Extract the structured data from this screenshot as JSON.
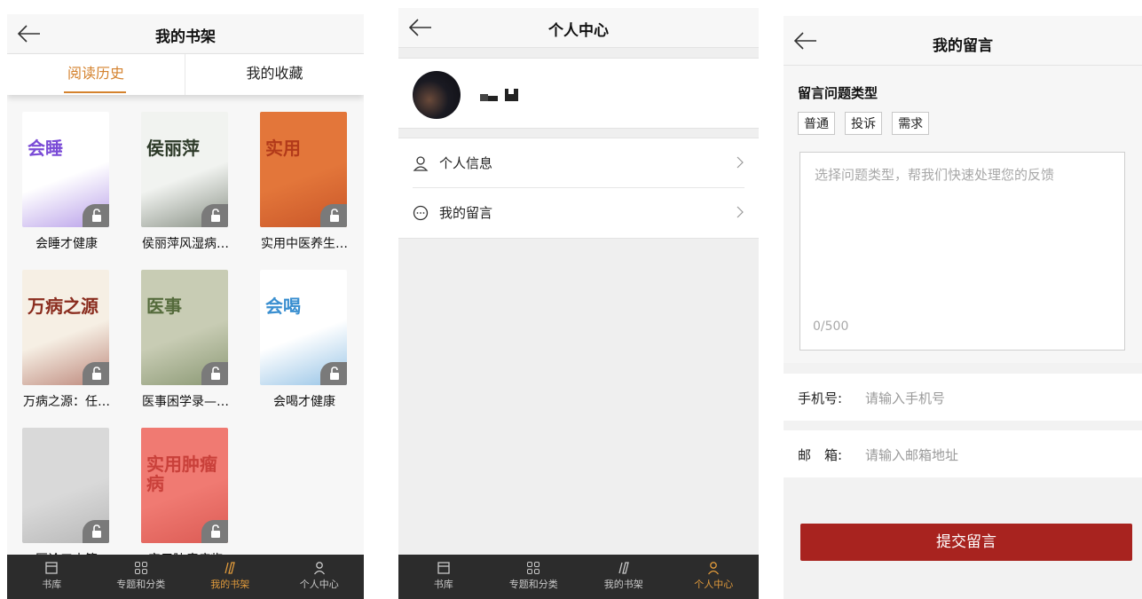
{
  "bookshelf": {
    "title": "我的书架",
    "tabs": [
      "阅读历史",
      "我的收藏"
    ],
    "books": [
      {
        "title": "会睡才健康",
        "cover_text": "会睡",
        "cover_color": "#ffffff",
        "accent": "#7a4bd6"
      },
      {
        "title": "侯丽萍风湿病…",
        "cover_text": "侯丽萍",
        "cover_color": "#f1f3f0",
        "accent": "#2d3a28"
      },
      {
        "title": "实用中医养生…",
        "cover_text": "实用",
        "cover_color": "#e3763a",
        "accent": "#b23a1a"
      },
      {
        "title": "万病之源：任…",
        "cover_text": "万病之源",
        "cover_color": "#f6efe4",
        "accent": "#8a2c1e"
      },
      {
        "title": "医事困学录—…",
        "cover_text": "医事",
        "cover_color": "#c8ccb4",
        "accent": "#556b3c"
      },
      {
        "title": "会喝才健康",
        "cover_text": "会喝",
        "cover_color": "#ffffff",
        "accent": "#3a8fd0"
      },
      {
        "title": "医论三十篇",
        "cover_text": "",
        "cover_color": "#d9d9d9",
        "accent": "#9a9a9a"
      },
      {
        "title": "实用肿瘤病临",
        "cover_text": "实用肿瘤病",
        "cover_color": "#f07a72",
        "accent": "#c9403a"
      }
    ]
  },
  "tabbar": {
    "items": [
      "书库",
      "专题和分类",
      "我的书架",
      "个人中心"
    ]
  },
  "profile": {
    "title": "个人中心",
    "menu": [
      "个人信息",
      "我的留言"
    ]
  },
  "message": {
    "title": "我的留言",
    "type_label": "留言问题类型",
    "types": [
      "普通",
      "投诉",
      "需求"
    ],
    "placeholder": "选择问题类型，帮我们快速处理您的反馈",
    "counter": "0/500",
    "phone_label": "手机号:",
    "phone_placeholder": "请输入手机号",
    "email_label": "邮　箱:",
    "email_placeholder": "请输入邮箱地址",
    "submit": "提交留言"
  },
  "colors": {
    "accent_orange": "#e09a3b",
    "submit_red": "#a8231f",
    "tabbar_dark": "#2c2c2c"
  }
}
